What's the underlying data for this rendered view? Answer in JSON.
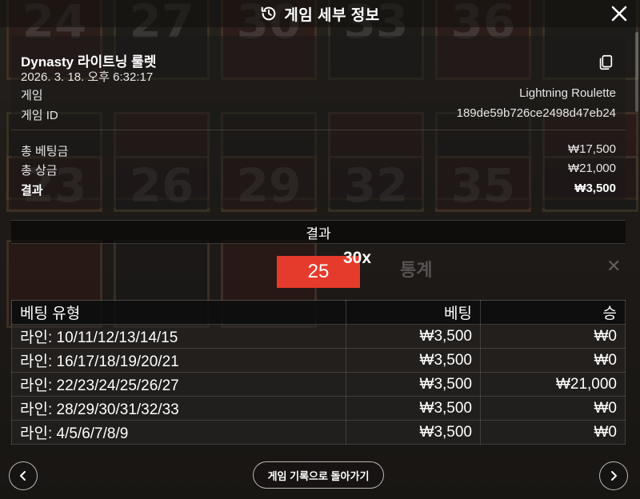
{
  "header": {
    "title": "게임 세부 정보"
  },
  "details": {
    "game_name": "Dynasty 라이트닝 룰렛",
    "datetime": "2026. 3. 18. 오후 6:32:17",
    "game_label": "게임",
    "game_value": "Lightning Roulette",
    "game_id_label": "게임 ID",
    "game_id_value": "189de59b726ce2498d47eb24",
    "total_bet_label": "총 베팅금",
    "total_bet_value": "₩17,500",
    "total_win_label": "총 상금",
    "total_win_value": "₩21,000",
    "result_label": "결과",
    "result_value": "₩3,500"
  },
  "result": {
    "header": "결과",
    "number": "25",
    "multiplier": "30x"
  },
  "bets": {
    "columns": [
      "베팅 유형",
      "베팅",
      "승"
    ],
    "rows": [
      {
        "type": "라인: 10/11/12/13/14/15",
        "bet": "₩3,500",
        "win": "₩0"
      },
      {
        "type": "라인: 16/17/18/19/20/21",
        "bet": "₩3,500",
        "win": "₩0"
      },
      {
        "type": "라인: 22/23/24/25/26/27",
        "bet": "₩3,500",
        "win": "₩21,000"
      },
      {
        "type": "라인: 28/29/30/31/32/33",
        "bet": "₩3,500",
        "win": "₩0"
      },
      {
        "type": "라인: 4/5/6/7/8/9",
        "bet": "₩3,500",
        "win": "₩0"
      }
    ]
  },
  "footer": {
    "back_label": "게임 기록으로 돌아가기"
  },
  "background": {
    "stats_title": "통계",
    "row1": [
      "24",
      "27",
      "30",
      "33",
      "36"
    ],
    "row2": [
      "23",
      "26",
      "29",
      "32",
      "35"
    ]
  },
  "colors": {
    "result_red": "#e53b2c"
  },
  "icons": {
    "header": "history-icon",
    "close": "close-icon",
    "copy": "copy-icon",
    "prev": "chevron-left-icon",
    "next": "chevron-right-icon"
  }
}
